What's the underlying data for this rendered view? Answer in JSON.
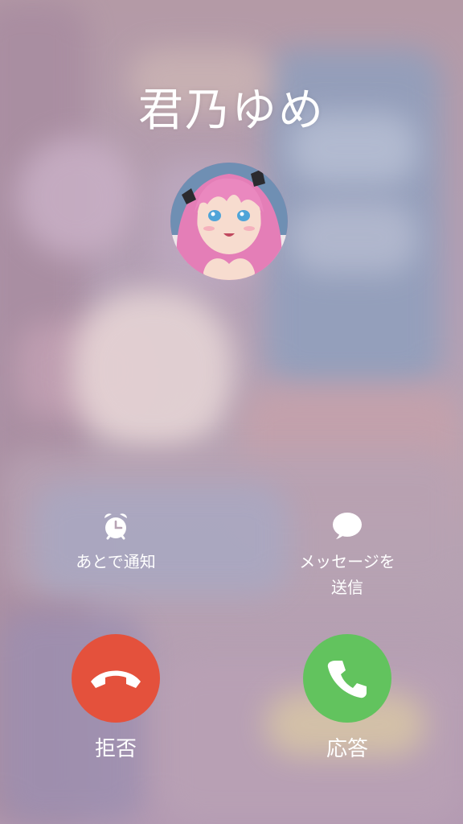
{
  "caller": {
    "name": "君乃ゆめ"
  },
  "quick_actions": {
    "remind": {
      "label": "あとで通知",
      "icon": "alarm-clock-icon"
    },
    "message": {
      "label_line1": "メッセージを",
      "label_line2": "送信",
      "icon": "speech-bubble-icon"
    }
  },
  "call_actions": {
    "decline": {
      "label": "拒否",
      "icon": "phone-down-icon",
      "color": "#e4513c"
    },
    "accept": {
      "label": "応答",
      "icon": "phone-icon",
      "color": "#62c35e"
    }
  }
}
